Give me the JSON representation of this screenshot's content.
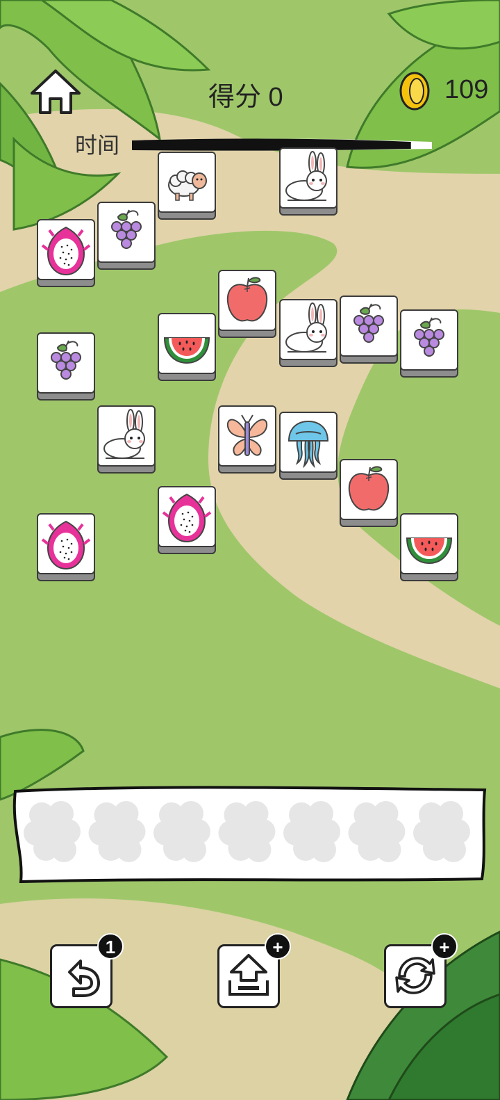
{
  "header": {
    "score_label": "得分 0",
    "coins": "109",
    "time_label": "时间"
  },
  "timer": {
    "remaining_fraction": 0.93
  },
  "board": {
    "tiles": [
      {
        "id": "sheep-1",
        "icon": "sheep-icon",
        "top": true
      },
      {
        "id": "rabbit-1",
        "icon": "rabbit-icon",
        "top": true
      },
      {
        "id": "grape-1",
        "icon": "grapes-icon",
        "top": true
      },
      {
        "id": "dragonfruit-1",
        "icon": "dragonfruit-icon",
        "top": true
      },
      {
        "id": "apple-1",
        "icon": "apple-icon",
        "top": true
      },
      {
        "id": "watermelon-1",
        "icon": "watermelon-icon",
        "top": true
      },
      {
        "id": "rabbit-2",
        "icon": "rabbit-icon",
        "top": true
      },
      {
        "id": "grape-2",
        "icon": "grapes-icon",
        "top": true
      },
      {
        "id": "grape-3",
        "icon": "grapes-icon",
        "top": true
      },
      {
        "id": "grape-4",
        "icon": "grapes-icon",
        "top": true
      },
      {
        "id": "rabbit-3",
        "icon": "rabbit-icon",
        "top": true
      },
      {
        "id": "butterfly-1",
        "icon": "butterfly-icon",
        "top": true
      },
      {
        "id": "jellyfish-1",
        "icon": "jellyfish-icon",
        "top": true
      },
      {
        "id": "dragonfruit-2",
        "icon": "dragonfruit-icon",
        "top": true
      },
      {
        "id": "apple-2",
        "icon": "apple-icon",
        "top": true
      },
      {
        "id": "dragonfruit-3",
        "icon": "dragonfruit-icon",
        "top": true
      },
      {
        "id": "watermelon-2",
        "icon": "watermelon-icon",
        "top": true
      }
    ]
  },
  "slots": {
    "count": 7,
    "filled": 0
  },
  "tools": [
    {
      "name": "undo",
      "icon": "undo-icon",
      "badge": "1"
    },
    {
      "name": "move-out",
      "icon": "move-out-icon",
      "badge": "+"
    },
    {
      "name": "shuffle",
      "icon": "shuffle-icon",
      "badge": "+"
    }
  ],
  "colors": {
    "grass": "#9fc76a",
    "path": "#e2d3aa",
    "leaf": "#7fbf4a",
    "leaf_dark": "#3f7a2a"
  }
}
